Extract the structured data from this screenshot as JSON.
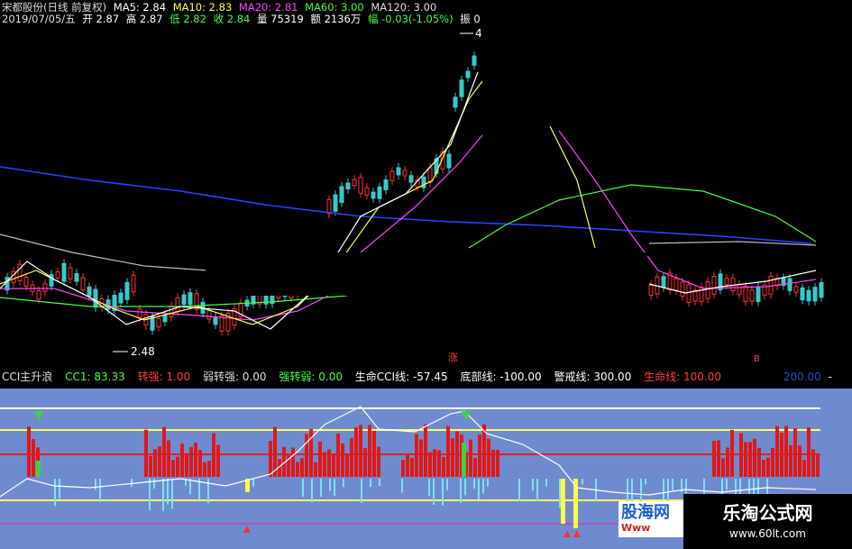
{
  "header": {
    "title": "宋都股份(日线 前复权)",
    "ma5": "MA5: 2.84",
    "ma10": "MA10: 2.83",
    "ma20": "MA20: 2.81",
    "ma60": "MA60: 3.00",
    "ma120": "MA120: 3.00",
    "date": "2019/07/05/五",
    "open": "开 2.87",
    "high": "高 2.87",
    "low": "低 2.82",
    "close": "收 2.84",
    "volume": "量 75319",
    "amount": "额 2136万",
    "change": "幅 -0.03(-1.05%)",
    "amplitude": "振 0"
  },
  "colors": {
    "ma5": "#ffffff",
    "ma10": "#ffff55",
    "ma20": "#ff44ff",
    "ma60": "#44ff44",
    "ma120": "#aaaaaa",
    "low": "#44ff44",
    "close": "#44ff44",
    "change": "#44ff44"
  },
  "main_annotations": {
    "low_price": "2.48",
    "high_price_partial": "4",
    "marker_zhang": "涨",
    "marker_b": "B"
  },
  "indicator": {
    "name": "CCI主升浪",
    "cci1": "CC1: 83.33",
    "zhuanqiang": "转强: 1.00",
    "ruozhuanqiang": "弱转强: 0.00",
    "qiangzhuanruo": "强转弱: 0.00",
    "shengming_cci": "生命CCI线: -57.45",
    "dibu": "底部线: -100.00",
    "jingjie": "警戒线: 300.00",
    "shengmingxian": "生命线: 100.00",
    "scroll_value": "200.00",
    "scroll_suffix": "-"
  },
  "watermarks": {
    "left_title": "股海网",
    "left_url": "Www",
    "right_title": "乐淘公式网",
    "right_url": "www.60lt.com"
  }
}
